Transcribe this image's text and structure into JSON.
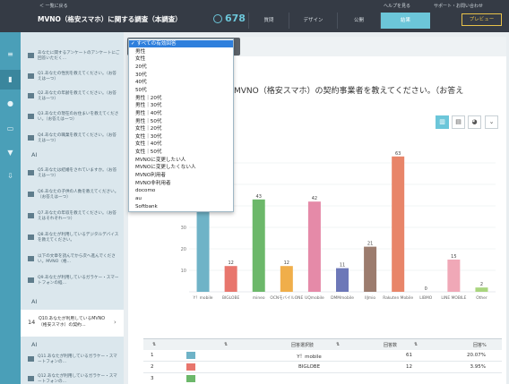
{
  "topbar": {
    "back": "＜ 一覧に戻る",
    "title": "MVNO（格安スマホ）に関する調査（本調査）",
    "count": "678",
    "help": "ヘルプを見る",
    "support": "サポート・お問い合わせ",
    "tabs": [
      "質問",
      "デザイン",
      "公開",
      "結果"
    ],
    "active_tab": "結果",
    "preview": "プレビュー"
  },
  "rail_icons": [
    "list-icon",
    "bar-chart-icon",
    "user-icon",
    "comment-icon",
    "filter-icon",
    "download-icon"
  ],
  "question_list": {
    "items": [
      "あなたに関するアンケートのアンケートにご回答いただく…",
      "Q1.あなたの性別を教えてください。（お答えは一つ）",
      "Q2.あなたの年齢を教えてください。（お答えは一つ）",
      "Q3.あなたの現在のお住まいを教えてください。（お答えは一つ）",
      "Q4.あなたの職業を教えてください。（お答えは一つ）",
      "Q5.あなたは結婚をされていますか。（お答えは一つ）",
      "Q6.あなたの子供の人数を教えてください。（お答えは一つ）",
      "Q7.あなたの年収を教えてください。（お答えはそれぞれ一つ）",
      "Q8.あなたが利用しているデジタルデバイスを教えてください。",
      "以下の文章を読んでから次へ進んでください。MVNO（格…",
      "Q9.あなたが利用しているガラケー・スマートフォンの経…",
      "Q11.あなたが利用しているガラケー・スマートフォンの…",
      "Q12.あなたが利用しているガラケー・スマートフォンの…"
    ],
    "section_label": "AI",
    "active": {
      "num": "14",
      "text": "Q10.あなたが利用しているMVNO（格安スマホ）の契約…"
    }
  },
  "question_heading": "いるMVNO（格安スマホ）の契約事業者を教えてください。（お答え",
  "view_buttons": [
    "bar-chart-icon",
    "column-chart-icon",
    "pie-chart-icon",
    "chevron-down-icon"
  ],
  "dropdown": {
    "selected": "すべての有効回答",
    "options": [
      "すべての有効回答",
      "男性",
      "女性",
      "20代",
      "30代",
      "40代",
      "50代",
      "男性｜20代",
      "男性｜30代",
      "男性｜40代",
      "男性｜50代",
      "女性｜20代",
      "女性｜30代",
      "女性｜40代",
      "女性｜50代",
      "MVNOに変更したい人",
      "MVNOに変更したくない人",
      "MVNO利用者",
      "MVNO非利用者",
      "docomo",
      "au",
      "Softbank"
    ]
  },
  "chart_data": {
    "type": "bar",
    "categories": [
      "Y！mobile",
      "BIGLOBE",
      "mineo",
      "OCNモバイルONE",
      "UQmobile",
      "DMMmobile",
      "IIJmio",
      "Rakuten Mobile",
      "LIBMO",
      "LINE MOBILE",
      "Other"
    ],
    "values": [
      61,
      12,
      43,
      12,
      42,
      11,
      21,
      63,
      0,
      15,
      2
    ],
    "colors": [
      "#6fb3c7",
      "#e8766d",
      "#6cb86a",
      "#f0ae4a",
      "#e58aa8",
      "#6d78b8",
      "#9c7c6e",
      "#e88569",
      "#d97ea4",
      "#f0a8b7",
      "#a9d57e"
    ],
    "yticks": [
      10,
      20,
      30,
      40,
      50,
      60
    ],
    "ylim": [
      0,
      70
    ]
  },
  "table": {
    "headers": [
      "回答選択肢",
      "回答数",
      "回答%"
    ],
    "rows": [
      {
        "n": "1",
        "label": "Y！mobile",
        "count": "61",
        "pct": "20.07%",
        "color": "#6fb3c7"
      },
      {
        "n": "2",
        "label": "BIGLOBE",
        "count": "12",
        "pct": "3.95%",
        "color": "#e8766d"
      },
      {
        "n": "3",
        "label": "",
        "count": "",
        "pct": "",
        "color": "#6cb86a"
      }
    ]
  }
}
